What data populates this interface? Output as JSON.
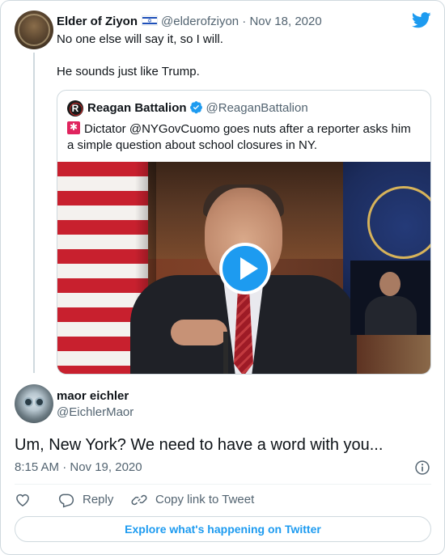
{
  "parent_tweet": {
    "author_name": "Elder of Ziyon",
    "author_handle": "@elderofziyon",
    "date": "Nov 18, 2020",
    "text_line1": "No one else will say it, so I will.",
    "text_line2": "He sounds just like Trump."
  },
  "quoted_tweet": {
    "author_name": "Reagan Battalion",
    "author_handle": "@ReaganBattalion",
    "verified": true,
    "text_line1": "Dictator @NYGovCuomo goes nuts after a reporter asks him",
    "text_line2": "a simple question about school closures in NY.",
    "video": {
      "has_play_button": true
    }
  },
  "reply_tweet": {
    "author_name": "maor eichler",
    "author_handle": "@EichlerMaor",
    "text": "Um, New York? We need to have a word with you...",
    "timestamp": "8:15 AM · Nov 19, 2020"
  },
  "actions": {
    "reply_label": "Reply",
    "copy_link_label": "Copy link to Tweet"
  },
  "footer": {
    "explore_label": "Explore what's happening on Twitter"
  },
  "colors": {
    "twitter_blue": "#1d9bf0",
    "text_primary": "#0f1419",
    "text_secondary": "#536471",
    "border": "#cfd9de"
  }
}
